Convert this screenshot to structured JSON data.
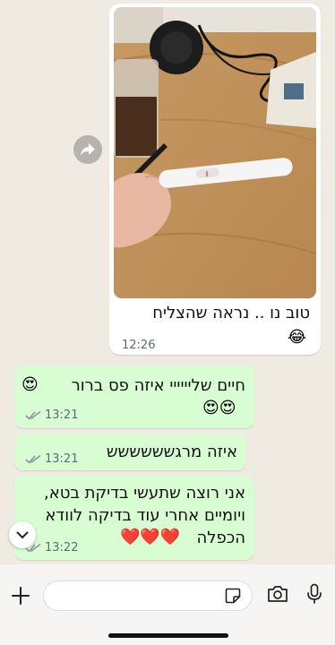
{
  "messages": {
    "incoming_image": {
      "caption": "טוב נו .. נראה שהצליח",
      "caption_emoji": "😂",
      "time": "12:26"
    },
    "outgoing": [
      {
        "line1": "חיים שליייייי איזה פס ברור",
        "emoji_line1": "😍",
        "emoji_line2": "😍😍",
        "time": "13:21"
      },
      {
        "text": "איזה מרגשששששש",
        "time": "13:21"
      },
      {
        "line1": "אני רוצה שתעשי בדיקת בטא,",
        "line2": "ויומיים אחרי עוד בדיקה לוודא",
        "line3": "הכפלה",
        "emoji": "❤️❤️❤️",
        "time": "13:22"
      }
    ]
  },
  "composer": {
    "placeholder": ""
  },
  "icons": {
    "forward": "forward-icon",
    "scroll_down": "chevron-down-icon",
    "plus": "plus-icon",
    "sticker": "sticker-icon",
    "camera": "camera-icon",
    "mic": "microphone-icon",
    "read_receipt": "double-check-icon"
  },
  "colors": {
    "background": "#efeae2",
    "outgoing_bubble": "#d9fdd3",
    "incoming_bubble": "#ffffff",
    "ticks": "#8a9599"
  }
}
